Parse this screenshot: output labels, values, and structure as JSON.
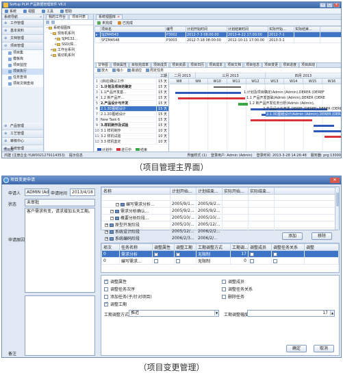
{
  "screen1": {
    "title": "Softup PLM 产品数据管理软件 V6.0",
    "menu": [
      "系统",
      "视图",
      "工具",
      "帮助"
    ],
    "nav": {
      "header": "系统导航",
      "groups_top": [
        "工作管理",
        "基本资料",
        "文档管理",
        "项目管理"
      ],
      "subs": [
        "项目集",
        "模板库",
        "项目监控",
        "项目执行",
        "任务查询",
        "项目文档查询"
      ],
      "groups_bottom": [
        "产品管理",
        "工艺管理",
        "审核中心",
        "系统管理"
      ],
      "version": "版本: 6.0",
      "project_dept": "项目部"
    },
    "tree": {
      "tabs": [
        "我的工作台",
        "项目列表",
        "系统视图库"
      ],
      "items": [
        "系统视图库",
        "现有机系列",
        "SJM132...",
        "SSD(焊...",
        "工作台系列",
        "铣切机系列"
      ]
    },
    "list": {
      "toolbar": [
        "未完成",
        "已完成"
      ],
      "headers": [
        "项目名",
        "编号",
        "计划开始时间",
        "计划结束时间",
        "实际开始...",
        "实际结束..."
      ],
      "rows": [
        [
          "SJZM4543",
          "P3002",
          "2012-7-3 08:00:00",
          "2013-4-22 17:00:00",
          "2012-7-1",
          ""
        ],
        [
          "SFZM4546",
          "P3003",
          "2012-7-18 08:00:00",
          "2012-10-11 17:00:00",
          "2013-3-1",
          ""
        ]
      ]
    },
    "detail_tabs": [
      "甘特图",
      "项目属性",
      "目标完成率",
      "项目成员",
      "项目资源",
      "项目日历",
      "项目成本",
      "项目文档",
      "项目信息",
      "项目变更",
      "项目进度",
      "项目启动"
    ],
    "gantt_tools": [
      "放大",
      "缩小",
      "最适应",
      "周定任务"
    ],
    "gantt": {
      "head": "工期",
      "tasks": [
        {
          "n": "1",
          "name": "(启动)确认工作",
          "dur": "15 天",
          "bold": false
        },
        {
          "n": "2",
          "name": "1.计划及项目的确定",
          "dur": "15 天",
          "bold": true
        },
        {
          "n": "3",
          "name": "1.1产品开发基...",
          "dur": "15 天",
          "bold": false
        },
        {
          "n": "4",
          "name": "1.2 新产品开...",
          "dur": "15 天",
          "bold": false
        },
        {
          "n": "5",
          "name": "2.产品设计与开发",
          "dur": "15 天",
          "bold": true
        },
        {
          "n": "6",
          "name": "2.1.3D图纸设计",
          "dur": "15 天",
          "bold": false,
          "sel": true
        },
        {
          "n": "7",
          "name": "2.1.2D图纸设计",
          "dur": "15 天",
          "bold": false
        },
        {
          "n": "8",
          "name": "New Task 6",
          "dur": "15 天",
          "bold": false
        },
        {
          "n": "9",
          "name": "3.样机制作及试验",
          "dur": "15 天",
          "bold": true
        },
        {
          "n": "10",
          "name": "3.1 样机制作",
          "dur": "10 天",
          "bold": false
        },
        {
          "n": "11",
          "name": "3.2 样机试验",
          "dur": "10 天",
          "bold": false
        },
        {
          "n": "12",
          "name": "3.3 样机鉴定",
          "dur": "10 天",
          "bold": false
        }
      ],
      "years": [
        "二月 2013",
        "三月 2013",
        "四月 2013"
      ],
      "weeks": [
        "W8",
        "W9",
        "W10",
        "W11",
        "W12",
        "W13",
        "W14",
        "W15",
        "W16"
      ],
      "bar_labels": [
        "1.计划及项目确定(Admin (Admin),DERER (DEREF",
        "1.1 产品开发基础(Admin (Admin),DERER (DERE",
        "1.2 新产品开发任务分析(Admin (Admin),",
        "2.产品设计与开发 DEREF (DEREF),DERER (DERE",
        "2.1.3D图纸设计(Admin (Admin),DERER (DERE",
        "2.1.2D图纸设计"
      ]
    },
    "legend": [
      "计划中",
      "进行中",
      "结束"
    ],
    "status": {
      "company": "鸿建 (注册企业:YLW0021279114353)",
      "prompt": "提示信息",
      "style": "界面样式 (1)",
      "user": "登录用户: Admin (Admin)",
      "login_time": "登录时间: 2013-3-28 14:26:48",
      "server": "服务器: prg:13000"
    }
  },
  "caption1": "（项目管理主界面）",
  "screen2": {
    "title": "项目变更申请",
    "applicant_label": "申请人",
    "applicant_value": "ADMIN (Adr",
    "time_label": "申请时间",
    "time_value": "2013/4/18",
    "state_label": "状态",
    "state_value": "未审批",
    "request_text": "客户需求有变，请求增加五天工期。",
    "reason_label": "申请原因",
    "remark_label": "备注",
    "tree_headers": [
      "名称",
      "计划开始...",
      "计划结束...",
      "实际开始...",
      "实际结束..."
    ],
    "tree_rows": [
      {
        "name": "",
        "ps": "",
        "pe": "",
        "indent": 0
      },
      {
        "name": "编写需求分析...",
        "ps": "2005/9/1...",
        "pe": "2005/9/2...",
        "indent": 2
      },
      {
        "name": "需求分析确认...",
        "ps": "2005/9/2...",
        "pe": "2005/9/2...",
        "indent": 1
      },
      {
        "name": "概要分析阶段...",
        "ps": "2005/10/...",
        "pe": "2005/10/...",
        "indent": 1
      },
      {
        "name": "原型开发阶段",
        "ps": "2005/10/...",
        "pe": "2005/12/...",
        "indent": 0
      },
      {
        "name": "系统设计阶段",
        "ps": "2005/12/...",
        "pe": "2006/2/2...",
        "indent": 0
      },
      {
        "name": "系统编码阶段",
        "ps": "2006/2/3...",
        "pe": "2006/2/...",
        "indent": 0
      }
    ],
    "add_btn": "添加",
    "remove_btn": "移除",
    "change_headers": [
      "项次",
      "任务名称",
      "调整属性",
      "调整工期",
      "工期调整方式",
      "工期调...",
      "调整成员",
      "调整任务关系",
      "调整"
    ],
    "change_rows": [
      {
        "no": "0",
        "name": "需求分析",
        "adj_attr": true,
        "adj_dur": true,
        "mode": "无限制",
        "val": "17",
        "sel": true
      },
      {
        "no": "0",
        "name": "编写需求...",
        "adj_attr": false,
        "adj_dur": false,
        "mode": "无限制",
        "val": "0",
        "sel": false
      }
    ],
    "checks_left": [
      {
        "label": "调整属性",
        "on": true
      },
      {
        "label": "调整任务次序",
        "on": false
      },
      {
        "label": "添加任务(子/针对项目)",
        "on": false
      },
      {
        "label": "调整工期",
        "on": true
      }
    ],
    "checks_right": [
      {
        "label": "调整成员",
        "on": false
      },
      {
        "label": "调整任务关系",
        "on": false
      },
      {
        "label": "删除任务",
        "on": false
      }
    ],
    "mode_label": "工期调整方式",
    "mode_value": "推迟",
    "days_label": "工期调整幅度",
    "days_value": "17",
    "ok_btn": "确定",
    "cancel_btn": "取消"
  },
  "caption2": "（项目变更管理）",
  "colors": {
    "accent": "#3d74c6",
    "titlebar": "#3a64a4",
    "bar_blue": "#2d59b8",
    "bar_red": "#d8333a",
    "bar_green": "#39a844"
  }
}
